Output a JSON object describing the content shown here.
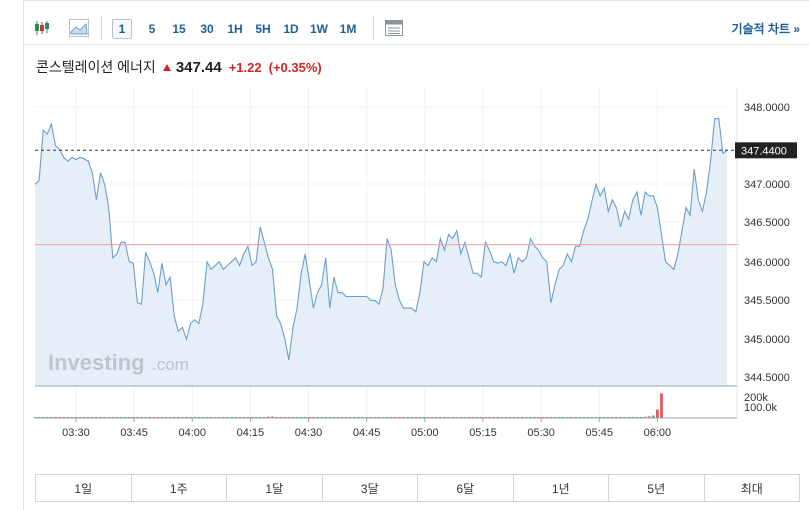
{
  "toolbar": {
    "intervals": [
      "1",
      "5",
      "15",
      "30",
      "1H",
      "5H",
      "1D",
      "1W",
      "1M"
    ],
    "active_interval": "1",
    "technical_chart_label": "기술적 차트 »"
  },
  "quote": {
    "name": "콘스텔레이션 에너지",
    "price": "347.44",
    "change": "+1.22",
    "change_pct": "(+0.35%)"
  },
  "ranges": [
    "1일",
    "1주",
    "1달",
    "3달",
    "6달",
    "1년",
    "5년",
    "최대"
  ],
  "colors": {
    "line": "#6a9fce",
    "fill": "#e6eef7",
    "up": "#d42424",
    "down": "#1f9e5a",
    "ref_line": "#f0a0a0",
    "price_box": "#222222"
  },
  "chart_data": {
    "type": "area",
    "watermark": "Investing.com",
    "x_tick_labels": [
      "03:30",
      "03:45",
      "04:00",
      "04:15",
      "04:30",
      "04:45",
      "05:00",
      "05:15",
      "05:30",
      "05:45",
      "06:00"
    ],
    "y_tick_labels": [
      "348.0000",
      "347.0000",
      "346.5000",
      "346.0000",
      "345.5000",
      "345.0000",
      "344.5000"
    ],
    "ylim": [
      344.35,
      348.2
    ],
    "current_price_label": "347.4400",
    "current_price": 347.44,
    "reference_line": 346.22,
    "volume_labels": [
      "200k",
      "100.0k"
    ],
    "volume_max": 250000,
    "x_minutes": [
      0,
      1,
      2,
      3,
      4,
      5,
      6,
      7,
      8,
      9,
      10,
      11,
      12,
      13,
      14,
      15,
      16,
      17,
      18,
      19,
      20,
      21,
      22,
      23,
      24,
      25,
      26,
      27,
      28,
      29,
      30,
      31,
      32,
      33,
      34,
      35,
      36,
      37,
      38,
      39,
      40,
      41,
      42,
      43,
      44,
      45,
      46,
      47,
      48,
      49,
      50,
      51,
      52,
      53,
      54,
      55,
      56,
      57,
      58,
      59,
      60,
      61,
      62,
      63,
      64,
      65,
      66,
      67,
      68,
      69,
      70,
      71,
      72,
      73,
      74,
      75,
      76,
      77,
      78,
      79,
      80,
      81,
      82,
      83,
      84,
      85,
      86,
      87,
      88,
      89,
      90,
      91,
      92,
      93,
      94,
      95,
      96,
      97,
      98,
      99,
      100,
      101,
      102,
      103,
      104,
      105,
      106,
      107,
      108,
      109,
      110,
      111,
      112,
      113,
      114,
      115,
      116,
      117,
      118,
      119,
      120,
      121,
      122,
      123,
      124,
      125,
      126,
      127,
      128,
      129,
      130,
      131,
      132,
      133,
      134,
      135,
      136,
      137,
      138,
      139,
      140,
      141,
      142,
      143,
      144,
      145,
      146,
      147,
      148,
      149,
      150,
      151,
      152
    ],
    "prices": [
      347.0,
      347.05,
      347.7,
      347.65,
      347.78,
      347.5,
      347.45,
      347.35,
      347.3,
      347.35,
      347.32,
      347.35,
      347.33,
      347.3,
      347.15,
      346.8,
      347.15,
      347.0,
      346.7,
      346.05,
      346.1,
      346.25,
      346.25,
      346.0,
      345.98,
      345.47,
      345.45,
      346.12,
      346.0,
      345.85,
      345.6,
      345.98,
      345.7,
      345.8,
      345.3,
      345.1,
      345.15,
      345.0,
      345.2,
      345.25,
      345.2,
      345.45,
      346.0,
      345.9,
      345.95,
      346.0,
      345.9,
      345.95,
      346.0,
      346.05,
      345.95,
      346.1,
      346.2,
      345.95,
      346.0,
      346.45,
      346.25,
      346.05,
      345.9,
      345.3,
      345.2,
      345.0,
      344.73,
      345.15,
      345.4,
      345.85,
      346.1,
      345.75,
      345.4,
      345.6,
      345.7,
      346.05,
      345.4,
      345.8,
      345.6,
      345.6,
      345.55,
      345.55,
      345.55,
      345.55,
      345.55,
      345.55,
      345.5,
      345.5,
      345.45,
      345.65,
      346.3,
      346.15,
      345.7,
      345.5,
      345.4,
      345.4,
      345.4,
      345.35,
      345.6,
      346.0,
      345.95,
      346.05,
      346.0,
      346.3,
      346.15,
      346.35,
      346.3,
      346.4,
      346.1,
      346.25,
      346.05,
      345.85,
      345.85,
      345.8,
      346.25,
      346.15,
      346.0,
      345.98,
      346.0,
      345.95,
      346.1,
      345.85,
      346.05,
      346.0,
      346.05,
      346.3,
      346.2,
      346.15,
      346.05,
      346.0,
      345.47,
      345.7,
      345.9,
      345.95,
      346.1,
      346.0,
      346.2,
      346.2,
      346.4,
      346.55,
      346.78,
      347.0,
      346.85,
      346.95,
      346.65,
      346.8,
      346.7,
      346.45,
      346.65,
      346.55,
      346.8,
      346.9,
      346.6,
      346.9,
      346.85,
      346.85,
      346.7,
      346.35,
      346.0,
      345.95,
      345.9,
      346.1,
      346.4,
      346.7,
      346.6,
      347.2,
      346.8,
      346.65,
      346.9,
      347.3,
      347.85,
      347.85,
      347.4,
      347.44
    ],
    "volumes": [
      2000,
      1500,
      1200,
      3000,
      2500,
      2000,
      2500,
      1500,
      2000,
      2500,
      3000,
      4000,
      2000,
      2500,
      1500,
      2000,
      5000,
      5500,
      4000,
      3000,
      3500,
      2500,
      2000,
      3000,
      4000,
      3500,
      2000,
      1500,
      2500,
      3500,
      3000,
      4000,
      3000,
      2500,
      2000,
      5000,
      8000,
      3000,
      2000,
      2500,
      2000,
      3000,
      6000,
      5000,
      3500,
      4000,
      3000,
      2500,
      3000,
      4000,
      3000,
      3500,
      7000,
      6500,
      10000,
      6000,
      8000,
      12000,
      13000,
      7000,
      5000,
      4000,
      3500,
      3000,
      2500,
      3000,
      2000,
      3500,
      3000,
      2500,
      2000,
      3000,
      2500,
      2000,
      2000,
      2500,
      2000,
      1500,
      2000,
      2500,
      3000,
      2000,
      1500,
      2000,
      3000,
      4000,
      3500,
      2500,
      2000,
      3000,
      2500,
      2000,
      1500,
      2000,
      3000,
      2500,
      2000,
      2500,
      3000,
      2500,
      3500,
      3000,
      2000,
      2500,
      2000,
      3000,
      2500,
      2000,
      3500,
      3000,
      2500,
      2000,
      3000,
      2500,
      2000,
      2500,
      3000,
      2000,
      2500,
      3000,
      2500,
      3500,
      3000,
      2500,
      3000,
      2500,
      2000,
      2500,
      3000,
      4000,
      3500,
      3000,
      2500,
      3000,
      2500,
      2000,
      3500,
      3000,
      2500,
      3000,
      4000,
      5000,
      6000,
      5000,
      8000,
      7000,
      10000,
      8000,
      9000,
      12000,
      14000,
      22000,
      75000,
      220000
    ]
  }
}
